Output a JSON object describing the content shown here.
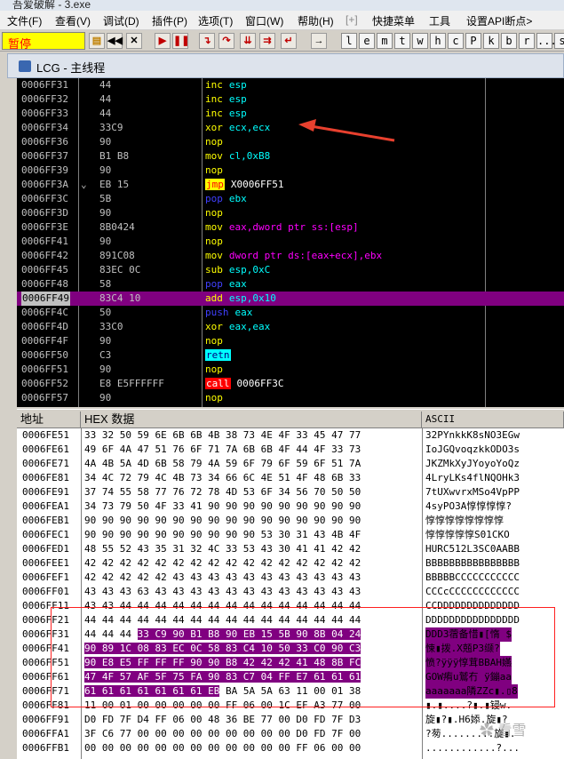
{
  "window_title": "吾爱破解 - 3.exe",
  "menu": [
    "文件(F)",
    "查看(V)",
    "调试(D)",
    "插件(P)",
    "选项(T)",
    "窗口(W)",
    "帮助(H)",
    "[+]",
    "快捷菜单",
    "工具",
    "设置API断点>"
  ],
  "toolbar": {
    "status": "暂停",
    "letters": [
      "l",
      "e",
      "m",
      "t",
      "w",
      "h",
      "c",
      "P",
      "k",
      "b",
      "r",
      "...",
      "s"
    ]
  },
  "cpu_window_title": "LCG - 主线程",
  "disassembly": [
    {
      "addr": "0006FF31",
      "mark": "",
      "hex": "44",
      "mn": "inc",
      "ops": "esp",
      "kind": "std"
    },
    {
      "addr": "0006FF32",
      "mark": "",
      "hex": "44",
      "mn": "inc",
      "ops": "esp",
      "kind": "std"
    },
    {
      "addr": "0006FF33",
      "mark": "",
      "hex": "44",
      "mn": "inc",
      "ops": "esp",
      "kind": "std"
    },
    {
      "addr": "0006FF34",
      "mark": "",
      "hex": "33C9",
      "mn": "xor",
      "ops": "ecx,ecx",
      "kind": "std"
    },
    {
      "addr": "0006FF36",
      "mark": "",
      "hex": "90",
      "mn": "nop",
      "ops": "",
      "kind": "std"
    },
    {
      "addr": "0006FF37",
      "mark": "",
      "hex": "B1 B8",
      "mn": "mov",
      "ops": "cl,0xB8",
      "kind": "std"
    },
    {
      "addr": "0006FF39",
      "mark": "",
      "hex": "90",
      "mn": "nop",
      "ops": "",
      "kind": "std"
    },
    {
      "addr": "0006FF3A",
      "mark": "⌄",
      "hex": "EB 15",
      "mn": "jmp",
      "ops": "X0006FF51",
      "kind": "jmp"
    },
    {
      "addr": "0006FF3C",
      "mark": "",
      "hex": "5B",
      "mn": "pop",
      "ops": "ebx",
      "kind": "stack"
    },
    {
      "addr": "0006FF3D",
      "mark": "",
      "hex": "90",
      "mn": "nop",
      "ops": "",
      "kind": "std"
    },
    {
      "addr": "0006FF3E",
      "mark": "",
      "hex": "8B0424",
      "mn": "mov",
      "ops": "eax,dword ptr ss:[esp]",
      "kind": "std"
    },
    {
      "addr": "0006FF41",
      "mark": "",
      "hex": "90",
      "mn": "nop",
      "ops": "",
      "kind": "std"
    },
    {
      "addr": "0006FF42",
      "mark": "",
      "hex": "891C08",
      "mn": "mov",
      "ops": "dword ptr ds:[eax+ecx],ebx",
      "kind": "std"
    },
    {
      "addr": "0006FF45",
      "mark": "",
      "hex": "83EC 0C",
      "mn": "sub",
      "ops": "esp,0xC",
      "kind": "std"
    },
    {
      "addr": "0006FF48",
      "mark": "",
      "hex": "58",
      "mn": "pop",
      "ops": "eax",
      "kind": "stack"
    },
    {
      "addr": "0006FF49",
      "mark": "",
      "hex": "83C4 10",
      "mn": "add",
      "ops": "esp,0x10",
      "kind": "std",
      "selected": true
    },
    {
      "addr": "0006FF4C",
      "mark": "",
      "hex": "50",
      "mn": "push",
      "ops": "eax",
      "kind": "stack"
    },
    {
      "addr": "0006FF4D",
      "mark": "",
      "hex": "33C0",
      "mn": "xor",
      "ops": "eax,eax",
      "kind": "std"
    },
    {
      "addr": "0006FF4F",
      "mark": "",
      "hex": "90",
      "mn": "nop",
      "ops": "",
      "kind": "std"
    },
    {
      "addr": "0006FF50",
      "mark": "",
      "hex": "C3",
      "mn": "retn",
      "ops": "",
      "kind": "retn"
    },
    {
      "addr": "0006FF51",
      "mark": "",
      "hex": "90",
      "mn": "nop",
      "ops": "",
      "kind": "std"
    },
    {
      "addr": "0006FF52",
      "mark": "",
      "hex": "E8 E5FFFFFF",
      "mn": "call",
      "ops": "0006FF3C",
      "kind": "call"
    },
    {
      "addr": "0006FF57",
      "mark": "",
      "hex": "90",
      "mn": "nop",
      "ops": "",
      "kind": "std"
    }
  ],
  "dump_headers": {
    "addr": "地址",
    "hex": "HEX 数据",
    "ascii": "ASCII"
  },
  "dump": [
    {
      "addr": "0006FE51",
      "hex": "33 32 50 59 6E 6B 6B 4B 38 73 4E 4F 33 45 47 77",
      "ascii": "32PYnkkK8sNO3EGw"
    },
    {
      "addr": "0006FE61",
      "hex": "49 6F 4A 47 51 76 6F 71 7A 6B 6B 4F 44 4F 33 73",
      "ascii": "IoJGQvoqzkkODO3s"
    },
    {
      "addr": "0006FE71",
      "hex": "4A 4B 5A 4D 6B 58 79 4A 59 6F 79 6F 59 6F 51 7A",
      "ascii": "JKZMkXyJYoyoYoQz"
    },
    {
      "addr": "0006FE81",
      "hex": "34 4C 72 79 4C 4B 73 34 66 6C 4E 51 4F 48 6B 33",
      "ascii": "4LryLKs4flNQOHk3"
    },
    {
      "addr": "0006FE91",
      "hex": "37 74 55 58 77 76 72 78 4D 53 6F 34 56 70 50 50",
      "ascii": "7tUXwvrxMSo4VpPP"
    },
    {
      "addr": "0006FEA1",
      "hex": "34 73 79 50 4F 33 41 90 90 90 90 90 90 90 90 90",
      "ascii": "4syPO3A惇惇惇惇?"
    },
    {
      "addr": "0006FEB1",
      "hex": "90 90 90 90 90 90 90 90 90 90 90 90 90 90 90 90",
      "ascii": "惇惇惇惇惇惇惇惇"
    },
    {
      "addr": "0006FEC1",
      "hex": "90 90 90 90 90 90 90 90 90 90 53 30 31 43 4B 4F",
      "ascii": "惇惇惇惇惇S01CKO"
    },
    {
      "addr": "0006FED1",
      "hex": "48 55 52 43 35 31 32 4C 33 53 43 30 41 41 42 42",
      "ascii": "HURC512L3SC0AABB"
    },
    {
      "addr": "0006FEE1",
      "hex": "42 42 42 42 42 42 42 42 42 42 42 42 42 42 42 42",
      "ascii": "BBBBBBBBBBBBBBBB"
    },
    {
      "addr": "0006FEF1",
      "hex": "42 42 42 42 42 43 43 43 43 43 43 43 43 43 43 43",
      "ascii": "BBBBBCCCCCCCCCCC"
    },
    {
      "addr": "0006FF01",
      "hex": "43 43 43 63 43 43 43 43 43 43 43 43 43 43 43 43",
      "ascii": "CCCcCCCCCCCCCCCC"
    },
    {
      "addr": "0006FF11",
      "hex": "43 43 44 44 44 44 44 44 44 44 44 44 44 44 44 44",
      "ascii": "CCDDDDDDDDDDDDDD"
    },
    {
      "addr": "0006FF21",
      "hex": "44 44 44 44 44 44 44 44 44 44 44 44 44 44 44 44",
      "ascii": "DDDDDDDDDDDDDDDD"
    },
    {
      "addr": "0006FF31",
      "hex_plain": "44 44 44 ",
      "hex_hl": "33 C9 90 B1 B8 90 EB 15 5B 90 8B 04 24",
      "ascii": "DDD3蓿备惜▮[惰 $"
    },
    {
      "addr": "0006FF41",
      "hex_hl": "90 89 1C 08 83 EC 0C 58 83 C4 10 50 33 C0 90 C3",
      "ascii": "悚▮拨.X兡P3缬?"
    },
    {
      "addr": "0006FF51",
      "hex_hl": "90 E8 E5 FF FF FF 90 90 B8 42 42 42 41 48 8B FC",
      "ascii": "愤?ÿÿÿ惇茸BBAH嬿"
    },
    {
      "addr": "0006FF61",
      "hex_hl": "47 4F 57 AF 5F 75 FA 90 83 C7 04 FF E7 61 61 61",
      "ascii": "GOW痏u鷲冇 ÿ鏰aa"
    },
    {
      "addr": "0006FF71",
      "hex_hl": "61 61 61 61 61 61 61 EB",
      "hex_plain": " BA 5A 5A 63 11 00 01 38",
      "ascii": "aaaaaaa隣ZZc▮.▯8"
    },
    {
      "addr": "0006FF81",
      "hex": "11 00 01 00 00 00 00 00 FF 06 00 1C EF A3 77 00",
      "ascii": "▮.▮....?▮.▮锓w."
    },
    {
      "addr": "0006FF91",
      "hex": "D0 FD 7F D4 FF 06 00 48 36 BE 77 00 D0 FD 7F D3",
      "ascii": "旋▮?▮.H6婖.旋▮?"
    },
    {
      "addr": "0006FFA1",
      "hex": "3F C6 77 00 00 00 00 00 00 00 00 00 D0 FD 7F 00",
      "ascii": "?茐.........旋▮."
    },
    {
      "addr": "0006FFB1",
      "hex": "00 00 00 00 00 00 00 00 00 00 00 00 FF 06 00 00",
      "ascii": "............?..."
    }
  ],
  "colors": {
    "selection": "#800080",
    "annotation_red": "#ff2020"
  }
}
